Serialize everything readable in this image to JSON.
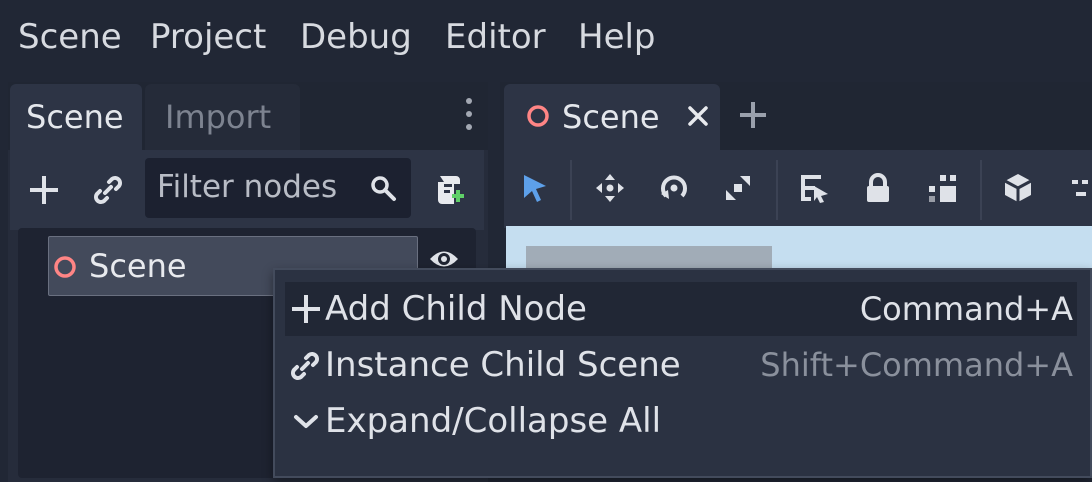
{
  "menubar": {
    "items": [
      "Scene",
      "Project",
      "Debug",
      "Editor",
      "Help"
    ]
  },
  "left_dock": {
    "tabs": [
      {
        "label": "Scene",
        "active": true
      },
      {
        "label": "Import",
        "active": false
      }
    ],
    "filter": {
      "placeholder": "Filter nodes",
      "value": ""
    },
    "tree": {
      "rows": [
        {
          "label": "Scene",
          "icon": "node-circle-icon",
          "visible": true
        }
      ]
    }
  },
  "viewport": {
    "tabs": [
      {
        "label": "Scene",
        "closable": true
      }
    ],
    "toolbar": [
      "select-tool-icon",
      "move-tool-icon",
      "rotate-tool-icon",
      "scale-tool-icon",
      "list-select-icon",
      "lock-icon",
      "group-icon",
      "mesh-icon",
      "snap-icon"
    ]
  },
  "context_menu": {
    "items": [
      {
        "label": "Add Child Node",
        "shortcut": "Command+A",
        "icon": "plus-icon",
        "highlighted": true
      },
      {
        "label": "Instance Child Scene",
        "shortcut": "Shift+Command+A",
        "icon": "link-icon",
        "highlighted": false
      },
      {
        "label": "Expand/Collapse All",
        "shortcut": "",
        "icon": "chevron-down-icon",
        "highlighted": false
      }
    ]
  },
  "colors": {
    "background": "#212735",
    "panel": "#2d3445",
    "node_icon": "#ff8585",
    "accent": "#5da0ea",
    "viewport": "#c5def0"
  }
}
